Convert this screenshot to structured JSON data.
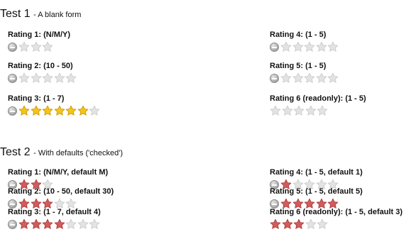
{
  "colors": {
    "star_empty_fill": "#e3e3e3",
    "star_empty_stroke": "#c8c8c8",
    "star_gold_fill": "#f4c419",
    "star_gold_stroke": "#c99400",
    "star_red_fill": "#d05c5c",
    "star_red_stroke": "#a83a3a",
    "cancel_icon": "#a0a0a0"
  },
  "tests": [
    {
      "title": "Test 1",
      "subtitle": "- A blank form",
      "ratings": [
        {
          "label": "Rating 1: (N/M/Y)",
          "total": 3,
          "filled": 0,
          "style": "gold",
          "cancel": true
        },
        {
          "label": "Rating 2: (10 - 50)",
          "total": 5,
          "filled": 0,
          "style": "gold",
          "cancel": true
        },
        {
          "label": "Rating 3: (1 - 7)",
          "total": 7,
          "filled": 6,
          "style": "gold",
          "cancel": true
        },
        {
          "label": "Rating 4: (1 - 5)",
          "total": 5,
          "filled": 0,
          "style": "gold",
          "cancel": true
        },
        {
          "label": "Rating 5: (1 - 5)",
          "total": 5,
          "filled": 0,
          "style": "gold",
          "cancel": true
        },
        {
          "label": "Rating 6 (readonly): (1 - 5)",
          "total": 5,
          "filled": 0,
          "style": "gold",
          "cancel": false
        }
      ]
    },
    {
      "title": "Test 2",
      "subtitle": "- With defaults ('checked')",
      "ratings": [
        {
          "label": "Rating 1: (N/M/Y, default M)",
          "total": 3,
          "filled": 2,
          "style": "red",
          "cancel": true
        },
        {
          "label": "Rating 2: (10 - 50, default 30)",
          "total": 5,
          "filled": 3,
          "style": "red",
          "cancel": true
        },
        {
          "label": "Rating 3: (1 - 7, default 4)",
          "total": 7,
          "filled": 4,
          "style": "red",
          "cancel": true
        },
        {
          "label": "Rating 4: (1 - 5, default 1)",
          "total": 5,
          "filled": 1,
          "style": "red",
          "cancel": true
        },
        {
          "label": "Rating 5: (1 - 5, default 5)",
          "total": 5,
          "filled": 5,
          "style": "red",
          "cancel": true
        },
        {
          "label": "Rating 6 (readonly): (1 - 5, default 3)",
          "total": 5,
          "filled": 3,
          "style": "red",
          "cancel": false
        }
      ]
    }
  ]
}
